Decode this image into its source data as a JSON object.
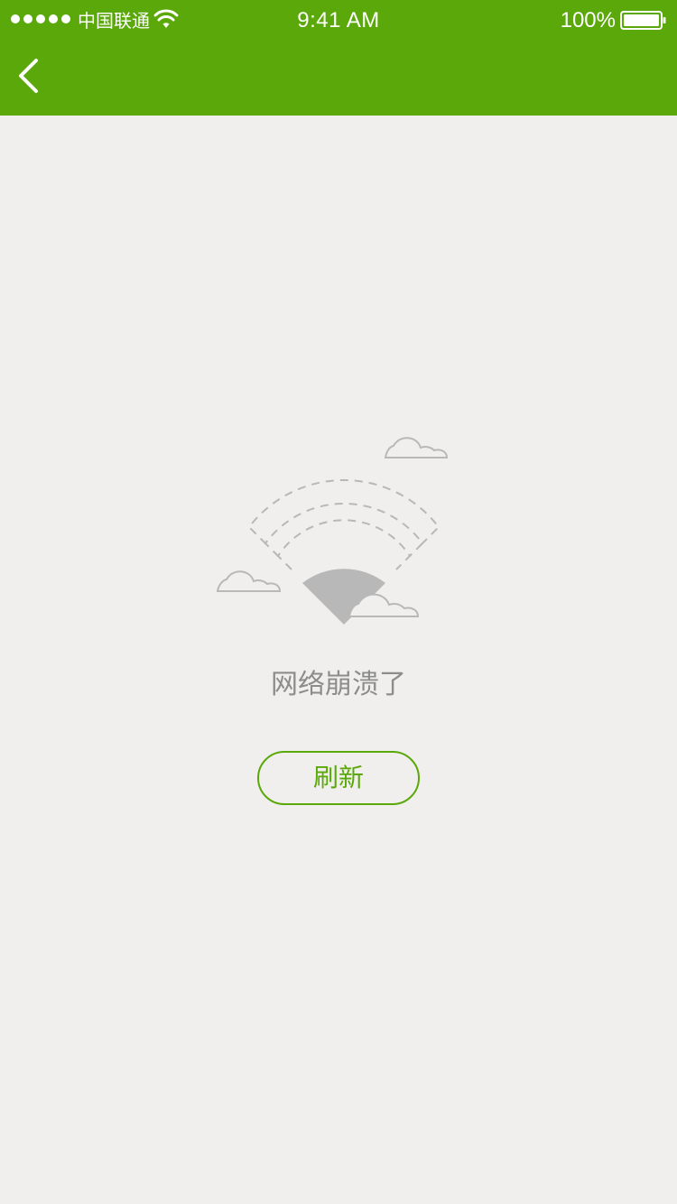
{
  "status_bar": {
    "signal_dots": 5,
    "carrier": "中国联通",
    "time": "9:41 AM",
    "battery_percent": "100%",
    "icons": [
      "signal-icon",
      "wifi-icon",
      "battery-icon"
    ]
  },
  "header": {
    "back_icon": "chevron-left-icon"
  },
  "main": {
    "illustration": "network-error-icon",
    "message": "网络崩溃了",
    "refresh_label": "刷新"
  },
  "colors": {
    "accent": "#5aa809",
    "background": "#f0efed",
    "message_text": "#8c8c8c",
    "illustration_gray": "#b8b8b8"
  }
}
